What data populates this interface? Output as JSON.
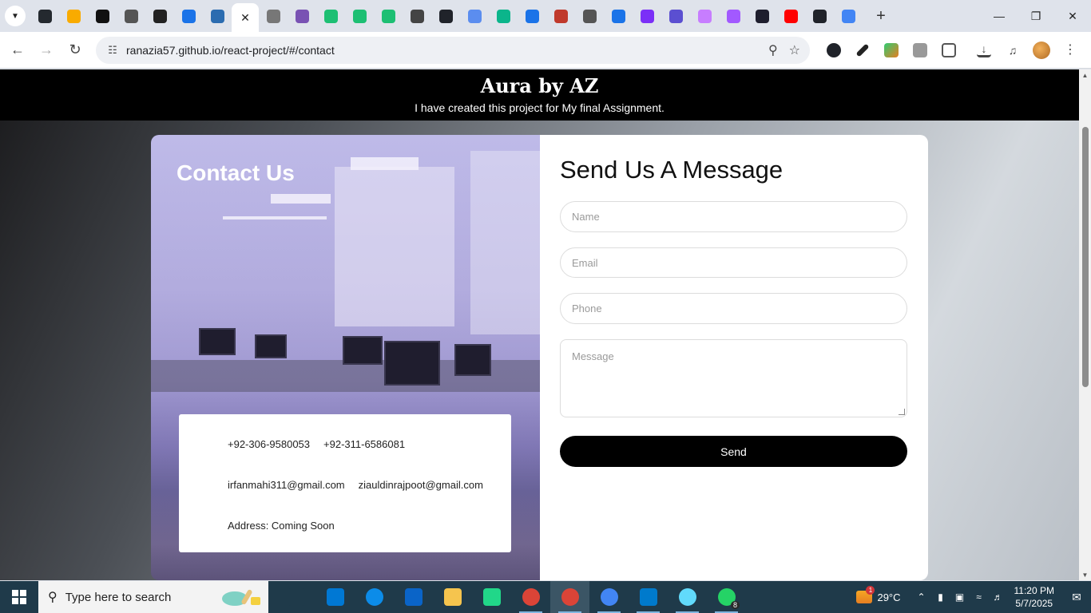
{
  "browser": {
    "tab_favicons": [
      {
        "icon": "github-icon",
        "color": "#24292f"
      },
      {
        "icon": "analytics-icon",
        "color": "#f9ab00"
      },
      {
        "icon": "threads-icon",
        "color": "#111111"
      },
      {
        "icon": "cloud-icon",
        "color": "#555555"
      },
      {
        "icon": "openai-icon",
        "color": "#222222"
      },
      {
        "icon": "chrome-web-icon",
        "color": "#1a73e8"
      },
      {
        "icon": "shield-icon",
        "color": "#2b6cb0"
      },
      {
        "icon": "close-icon",
        "color": "#222222",
        "active": true
      },
      {
        "icon": "camera-icon",
        "color": "#777777"
      },
      {
        "icon": "bootstrap-icon",
        "color": "#7952b3"
      },
      {
        "icon": "fiverr-icon",
        "color": "#1dbf73"
      },
      {
        "icon": "fiverr-icon",
        "color": "#1dbf73"
      },
      {
        "icon": "fiverr-icon",
        "color": "#1dbf73"
      },
      {
        "icon": "vscode-insiders-icon",
        "color": "#444444"
      },
      {
        "icon": "react-icon",
        "color": "#20232a"
      },
      {
        "icon": "dotted-icon",
        "color": "#5b8def"
      },
      {
        "icon": "slash-icon",
        "color": "#0bb58b"
      },
      {
        "icon": "docs-icon",
        "color": "#1a73e8"
      },
      {
        "icon": "dots-icon",
        "color": "#c0392b"
      },
      {
        "icon": "cloud-icon",
        "color": "#555555"
      },
      {
        "icon": "play-icon",
        "color": "#1a73e8"
      },
      {
        "icon": "check-icon",
        "color": "#7b2ff7"
      },
      {
        "icon": "circle-icon",
        "color": "#5b4fd1"
      },
      {
        "icon": "avatar-icon",
        "color": "#c77dff"
      },
      {
        "icon": "figma-icon",
        "color": "#a259ff"
      },
      {
        "icon": "ui-icon",
        "color": "#1e1e2e"
      },
      {
        "icon": "youtube-icon",
        "color": "#ff0000"
      },
      {
        "icon": "react-icon",
        "color": "#20232a"
      },
      {
        "icon": "google-icon",
        "color": "#4285f4"
      }
    ],
    "url": "ranazia57.github.io/react-project/#/contact"
  },
  "site": {
    "title": "Aura by AZ",
    "subtitle": "I have created this project for My final Assignment."
  },
  "contact": {
    "heading": "Contact Us",
    "phone1": "+92-306-9580053",
    "phone2": "+92-311-6586081",
    "email1": "irfanmahi311@gmail.com",
    "email2": "ziauldinrajpoot@gmail.com",
    "address": "Address: Coming Soon"
  },
  "form": {
    "heading": "Send Us A Message",
    "name_placeholder": "Name",
    "email_placeholder": "Email",
    "phone_placeholder": "Phone",
    "message_placeholder": "Message",
    "send_label": "Send"
  },
  "taskbar": {
    "search_placeholder": "Type here to search",
    "apps": [
      {
        "icon": "task-view-icon",
        "color": "#1f3a4a"
      },
      {
        "icon": "ms-store-icon",
        "color": "#0078d4"
      },
      {
        "icon": "edge-icon",
        "color": "#0c8ce9"
      },
      {
        "icon": "outlook-icon",
        "color": "#0a64c8"
      },
      {
        "icon": "file-explorer-icon",
        "color": "#f5c44e"
      },
      {
        "icon": "pycharm-icon",
        "color": "#21d789"
      },
      {
        "icon": "chrome-icon",
        "color": "#db4437"
      },
      {
        "icon": "chrome-icon",
        "color": "#db4437",
        "active": true
      },
      {
        "icon": "chrome-icon",
        "color": "#4285f4"
      },
      {
        "icon": "vscode-icon",
        "color": "#007acc"
      },
      {
        "icon": "react-icon",
        "color": "#61dafb"
      },
      {
        "icon": "whatsapp-icon",
        "color": "#25d366",
        "badge": "8"
      }
    ],
    "weather_temp": "29°C",
    "weather_badge": "1",
    "time": "11:20 PM",
    "date": "5/7/2025"
  }
}
